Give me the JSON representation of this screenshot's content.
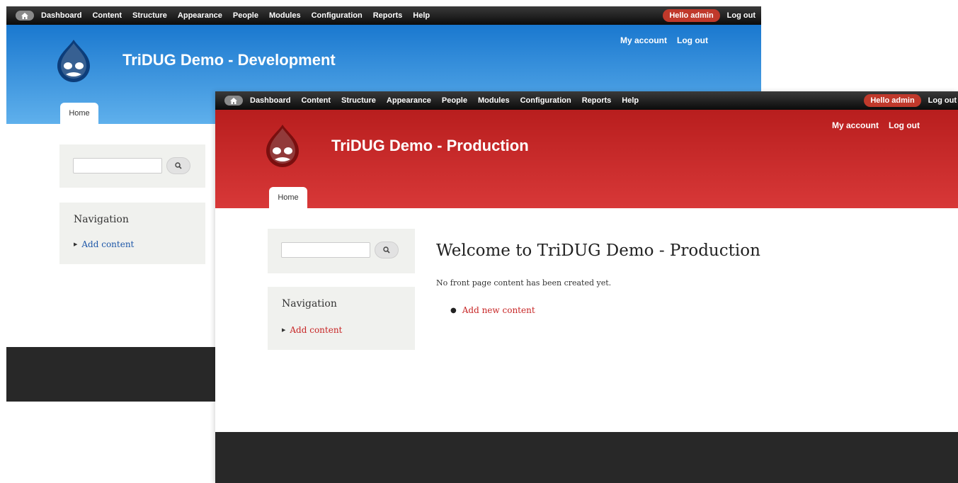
{
  "toolbar": {
    "menu": [
      "Dashboard",
      "Content",
      "Structure",
      "Appearance",
      "People",
      "Modules",
      "Configuration",
      "Reports",
      "Help"
    ],
    "hello": "Hello admin",
    "logout": "Log out",
    "home_icon": "home-icon"
  },
  "dev": {
    "site_name": "TriDUG Demo - Development",
    "secondary_links": [
      "My account",
      "Log out"
    ],
    "tab": "Home",
    "navigation_title": "Navigation",
    "nav_link": "Add content",
    "colors": {
      "header": "#1a78cf",
      "link": "#1d57a8"
    }
  },
  "prod": {
    "site_name": "TriDUG Demo - Production",
    "secondary_links": [
      "My account",
      "Log out"
    ],
    "tab": "Home",
    "navigation_title": "Navigation",
    "nav_link": "Add content",
    "welcome": "Welcome to TriDUG Demo - Production",
    "no_content": "No front page content has been created yet.",
    "add_new": "Add new content",
    "colors": {
      "header": "#c72525",
      "link": "#c72525"
    }
  }
}
